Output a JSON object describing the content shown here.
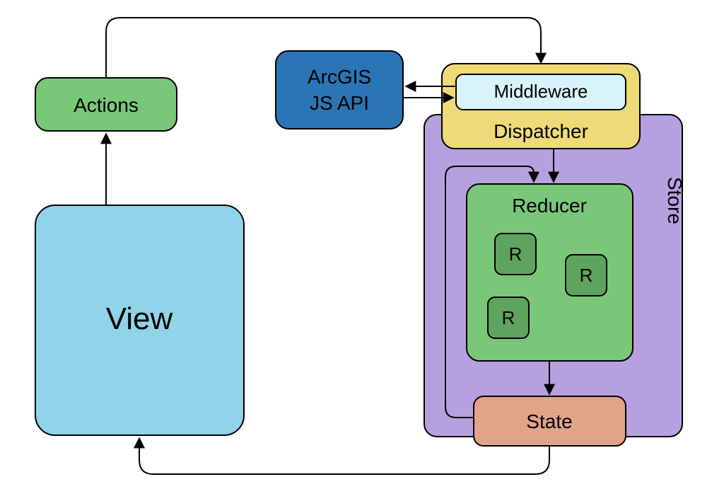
{
  "nodes": {
    "actions": {
      "label": "Actions",
      "fill": "#7ac779"
    },
    "arcgis": {
      "line1": "ArcGIS",
      "line2": "JS API",
      "fill": "#2a75b3"
    },
    "middleware": {
      "label": "Middleware",
      "fill": "#d9f3fb"
    },
    "dispatcher": {
      "label": "Dispatcher",
      "fill": "#eeda77"
    },
    "store": {
      "label": "Store",
      "fill": "#b7a0e0"
    },
    "reducer": {
      "label": "Reducer",
      "fill": "#7ac779",
      "sub": "R",
      "subfill": "#5fa45e"
    },
    "state": {
      "label": "State",
      "fill": "#e2a489"
    },
    "view": {
      "label": "View",
      "fill": "#91d3e9"
    }
  }
}
